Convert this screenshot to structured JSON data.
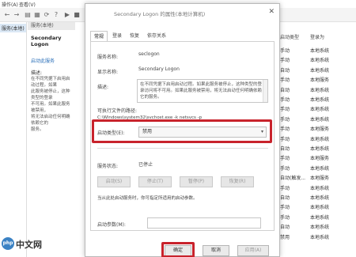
{
  "background": {
    "menu": [
      "操作(A)",
      "查看(V)"
    ],
    "left_nav": {
      "item": "服务(本地)"
    },
    "description_pane": {
      "header": "服务(本地)",
      "service_title": "Secondary Logon",
      "start_link": "启动此服务",
      "desc_label": "描述:",
      "desc_lines": [
        "在不同凭据下启用启动过程。如果",
        "此服务被停止，这种类型的登录",
        "不可用。如果此服务被禁用，",
        "将无法启动任何明确依赖它的",
        "服务。"
      ]
    },
    "right_columns": {
      "headers": [
        "启动类型",
        "登录为"
      ],
      "rows": [
        [
          "手动",
          "本地系统"
        ],
        [
          "手动",
          "本地系统"
        ],
        [
          "自动",
          "本地系统"
        ],
        [
          "手动",
          "本地服务"
        ],
        [
          "自动",
          "本地系统"
        ],
        [
          "手动",
          "本地系统"
        ],
        [
          "手动",
          "本地系统"
        ],
        [
          "手动",
          "本地系统"
        ],
        [
          "手动",
          "本地服务"
        ],
        [
          "手动",
          "本地系统"
        ],
        [
          "自动",
          "本地系统"
        ],
        [
          "手动",
          "本地服务"
        ],
        [
          "手动",
          "本地系统"
        ],
        [
          "自动(触发...",
          "本地服务"
        ],
        [
          "手动",
          "本地系统"
        ],
        [
          "自动",
          "本地系统"
        ],
        [
          "手动",
          "本地系统"
        ],
        [
          "手动",
          "本地系统"
        ],
        [
          "自动",
          "本地系统"
        ],
        [
          "禁用",
          "本地系统"
        ]
      ]
    }
  },
  "dialog": {
    "title": "Secondary Logon 的属性(本地计算机)",
    "tabs": [
      "常规",
      "登录",
      "恢复",
      "依存关系"
    ],
    "fields": {
      "service_name_label": "服务名称:",
      "service_name_value": "seclogon",
      "display_name_label": "显示名称:",
      "display_name_value": "Secondary Logon",
      "description_label": "描述:",
      "description_text": "在不同凭据下启用启动过程。如果此服务被停止，这种类型的登录访问将不可用。如果此服务被禁用，将无法启动任何明确依赖它的服务。",
      "exe_path_label": "可执行文件的路径:",
      "exe_path_value": "C:\\Windows\\system32\\svchost.exe -k netsvcs -p",
      "startup_type_label": "启动类型(E):",
      "startup_type_value": "禁用",
      "service_status_label": "服务状态:",
      "service_status_value": "已停止",
      "hint_text": "当从此处启动服务时，你可指定所适用的启动参数。",
      "start_params_label": "启动参数(M):"
    },
    "buttons": {
      "start": "启动(S)",
      "stop": "停止(T)",
      "pause": "暂停(P)",
      "resume": "恢复(R)"
    },
    "footer": {
      "ok": "确定",
      "cancel": "取消",
      "apply": "应用(A)"
    }
  },
  "watermark": {
    "logo": "php",
    "text": "中文网"
  },
  "colors": {
    "highlight": "#c8232c",
    "link": "#2a6fb9"
  }
}
